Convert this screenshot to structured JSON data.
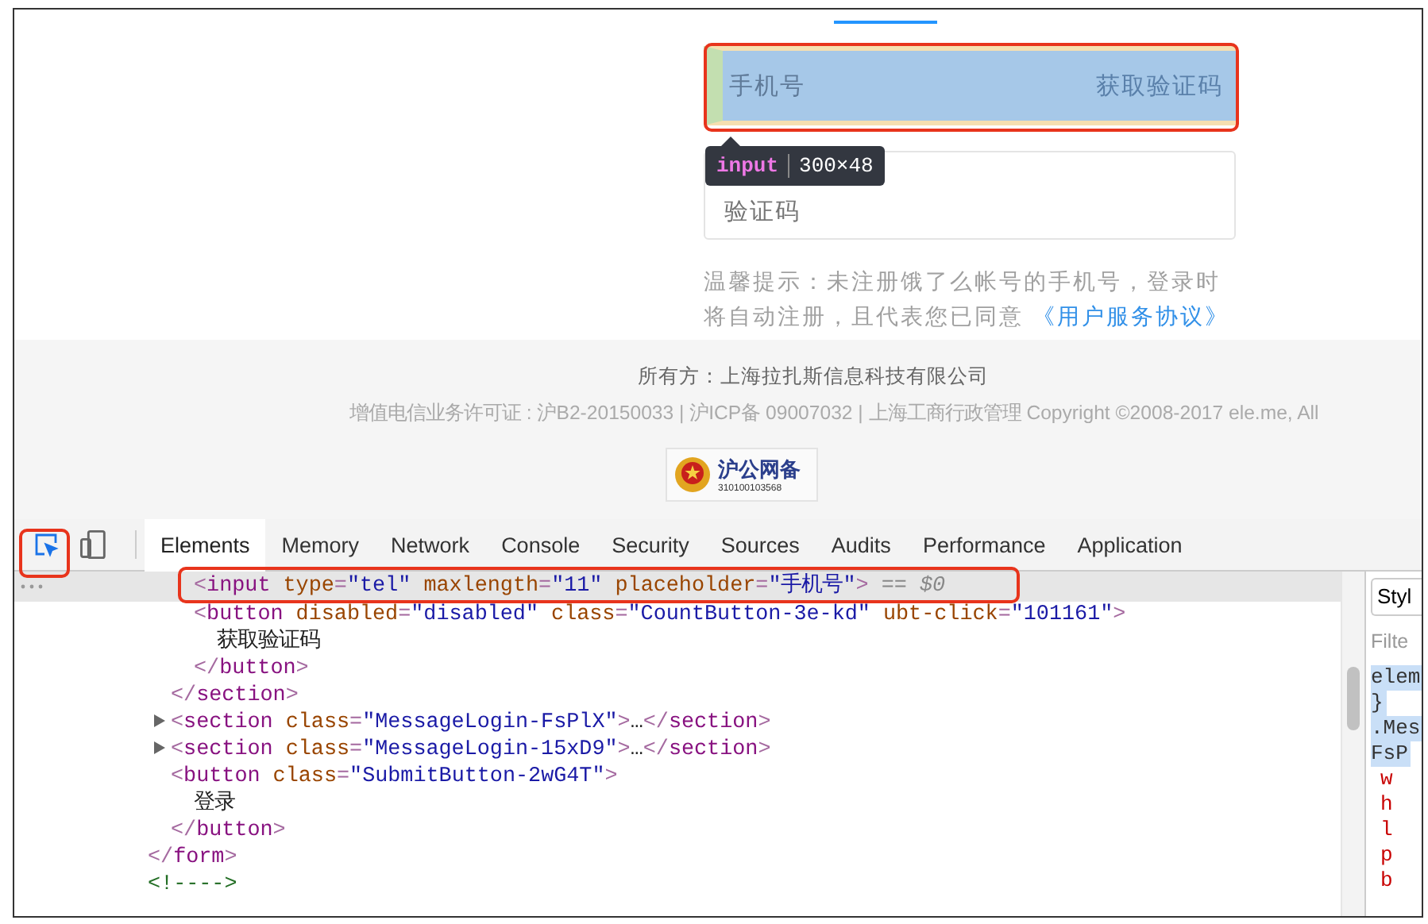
{
  "phone_field": {
    "placeholder": "手机号",
    "get_code_button": {
      "label": "获取验证码",
      "disabled": true
    }
  },
  "inspect_tooltip": {
    "tag": "input",
    "size": "300×48"
  },
  "code_field": {
    "placeholder": "验证码"
  },
  "hint": {
    "text": "温馨提示：未注册饿了么帐号的手机号，登录时将自动注册，且代表您已同意",
    "link": "《用户服务协议》"
  },
  "footer": {
    "owner": "所有方：上海拉扎斯信息科技有限公司",
    "license": "增值电信业务许可证 : 沪B2-20150033 | 沪ICP备 09007032 | 上海工商行政管理 Copyright ©2008-2017 ele.me, All",
    "badge": {
      "title": "沪公网备",
      "number": "310100103568"
    }
  },
  "devtools": {
    "inspect_button": {
      "selected": true
    },
    "tabs": [
      {
        "label": "Elements",
        "selected": true
      },
      {
        "label": "Memory",
        "selected": false
      },
      {
        "label": "Network",
        "selected": false
      },
      {
        "label": "Console",
        "selected": false
      },
      {
        "label": "Security",
        "selected": false
      },
      {
        "label": "Sources",
        "selected": false
      },
      {
        "label": "Audits",
        "selected": false
      },
      {
        "label": "Performance",
        "selected": false
      },
      {
        "label": "Application",
        "selected": false
      }
    ],
    "dom_tree": [
      {
        "children": [
          {
            "children": [
              {
                "selected": true,
                "tokens": [
                  {
                    "text": "<",
                    "kind": "punct"
                  },
                  {
                    "text": "input",
                    "kind": "tag"
                  },
                  {
                    "text": " type",
                    "kind": "attr"
                  },
                  {
                    "text": "=",
                    "kind": "punct"
                  },
                  {
                    "text": "\"tel\"",
                    "kind": "value"
                  },
                  {
                    "text": " maxlength",
                    "kind": "attr"
                  },
                  {
                    "text": "=",
                    "kind": "punct"
                  },
                  {
                    "text": "\"11\"",
                    "kind": "value"
                  },
                  {
                    "text": " placeholder",
                    "kind": "attr"
                  },
                  {
                    "text": "=",
                    "kind": "punct"
                  },
                  {
                    "text": "\"手机号\"",
                    "kind": "value"
                  },
                  {
                    "text": ">",
                    "kind": "punct"
                  },
                  {
                    "text": " == $0",
                    "kind": "ref"
                  }
                ]
              },
              {
                "selected": false,
                "tokens": [
                  {
                    "text": "<",
                    "kind": "punct"
                  },
                  {
                    "text": "button",
                    "kind": "tag"
                  },
                  {
                    "text": " disabled",
                    "kind": "attr"
                  },
                  {
                    "text": "=",
                    "kind": "punct"
                  },
                  {
                    "text": "\"disabled\"",
                    "kind": "value"
                  },
                  {
                    "text": " class",
                    "kind": "attr"
                  },
                  {
                    "text": "=",
                    "kind": "punct"
                  },
                  {
                    "text": "\"CountButton-3e-kd\"",
                    "kind": "value"
                  },
                  {
                    "text": " ubt-click",
                    "kind": "attr"
                  },
                  {
                    "text": "=",
                    "kind": "punct"
                  },
                  {
                    "text": "\"101161\"",
                    "kind": "value"
                  },
                  {
                    "text": ">",
                    "kind": "punct"
                  }
                ],
                "children": [
                  {
                    "selected": false,
                    "tokens": [
                      {
                        "text": "获取验证码",
                        "kind": "text"
                      }
                    ]
                  }
                ]
              },
              {
                "selected": false,
                "tokens": [
                  {
                    "text": "</",
                    "kind": "punct"
                  },
                  {
                    "text": "button",
                    "kind": "tag"
                  },
                  {
                    "text": ">",
                    "kind": "punct"
                  }
                ]
              }
            ]
          },
          {
            "selected": false,
            "tokens": [
              {
                "text": "</",
                "kind": "punct"
              },
              {
                "text": "section",
                "kind": "tag"
              },
              {
                "text": ">",
                "kind": "punct"
              }
            ]
          },
          {
            "selected": false,
            "expanded": false,
            "tokens": [
              {
                "text": "<",
                "kind": "punct"
              },
              {
                "text": "section",
                "kind": "tag"
              },
              {
                "text": " class",
                "kind": "attr"
              },
              {
                "text": "=",
                "kind": "punct"
              },
              {
                "text": "\"MessageLogin-FsPlX\"",
                "kind": "value"
              },
              {
                "text": ">",
                "kind": "punct"
              },
              {
                "text": "…",
                "kind": "text"
              },
              {
                "text": "</",
                "kind": "punct"
              },
              {
                "text": "section",
                "kind": "tag"
              },
              {
                "text": ">",
                "kind": "punct"
              }
            ]
          },
          {
            "selected": false,
            "expanded": false,
            "tokens": [
              {
                "text": "<",
                "kind": "punct"
              },
              {
                "text": "section",
                "kind": "tag"
              },
              {
                "text": " class",
                "kind": "attr"
              },
              {
                "text": "=",
                "kind": "punct"
              },
              {
                "text": "\"MessageLogin-15xD9\"",
                "kind": "value"
              },
              {
                "text": ">",
                "kind": "punct"
              },
              {
                "text": "…",
                "kind": "text"
              },
              {
                "text": "</",
                "kind": "punct"
              },
              {
                "text": "section",
                "kind": "tag"
              },
              {
                "text": ">",
                "kind": "punct"
              }
            ]
          },
          {
            "selected": false,
            "tokens": [
              {
                "text": "<",
                "kind": "punct"
              },
              {
                "text": "button",
                "kind": "tag"
              },
              {
                "text": " class",
                "kind": "attr"
              },
              {
                "text": "=",
                "kind": "punct"
              },
              {
                "text": "\"SubmitButton-2wG4T\"",
                "kind": "value"
              },
              {
                "text": ">",
                "kind": "punct"
              }
            ],
            "children": [
              {
                "selected": false,
                "tokens": [
                  {
                    "text": "登录",
                    "kind": "text"
                  }
                ]
              }
            ]
          },
          {
            "selected": false,
            "tokens": [
              {
                "text": "</",
                "kind": "punct"
              },
              {
                "text": "button",
                "kind": "tag"
              },
              {
                "text": ">",
                "kind": "punct"
              }
            ]
          }
        ]
      },
      {
        "selected": false,
        "tokens": [
          {
            "text": "</",
            "kind": "punct"
          },
          {
            "text": "form",
            "kind": "tag"
          },
          {
            "text": ">",
            "kind": "punct"
          }
        ]
      },
      {
        "selected": false,
        "tokens": [
          {
            "text": "<!---->",
            "kind": "comment"
          }
        ]
      }
    ],
    "styles_pane": {
      "tab": "Styl",
      "filter_placeholder": "Filte",
      "lines": [
        {
          "text": "elem",
          "kind": "selector"
        },
        {
          "text": "}",
          "kind": "selector"
        },
        {
          "text": ".Mes",
          "kind": "selector"
        },
        {
          "text": "FsP",
          "kind": "selector"
        },
        {
          "text": "w",
          "kind": "property"
        },
        {
          "text": "h",
          "kind": "property"
        },
        {
          "text": "l",
          "kind": "property"
        },
        {
          "text": "p",
          "kind": "property"
        },
        {
          "text": "b",
          "kind": "property"
        }
      ]
    }
  }
}
